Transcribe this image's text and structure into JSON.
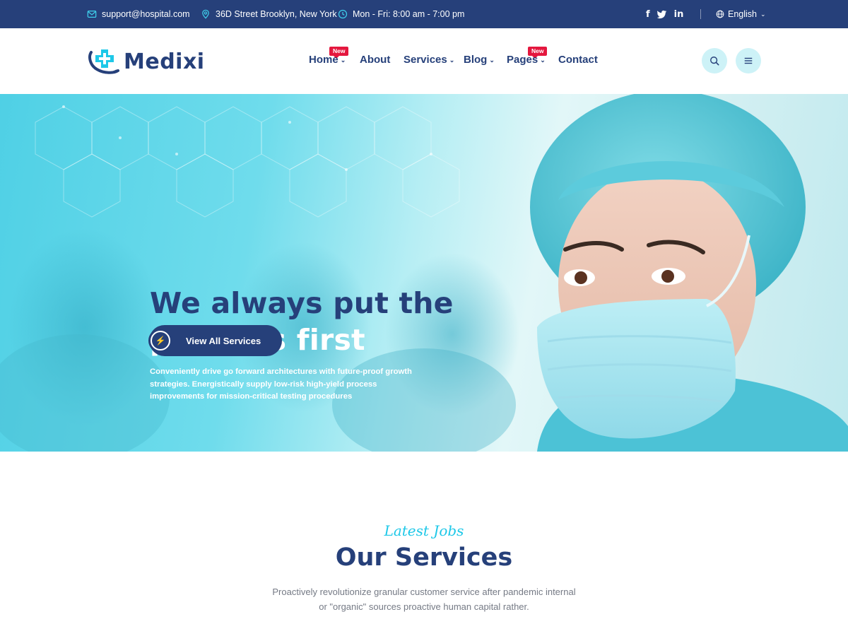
{
  "topbar": {
    "email": "support@hospital.com",
    "address": "36D Street Brooklyn, New York",
    "hours": "Mon - Fri: 8:00 am - 7:00 pm",
    "socials": [
      "f",
      "twitter",
      "in"
    ],
    "language": "English"
  },
  "brand": {
    "name": "Medixi"
  },
  "nav": {
    "items": [
      {
        "label": "Home",
        "has_dropdown": true,
        "badge": "New"
      },
      {
        "label": "About",
        "has_dropdown": false
      },
      {
        "label": "Services",
        "has_dropdown": true
      },
      {
        "label": "Blog",
        "has_dropdown": true
      },
      {
        "label": "Pages",
        "has_dropdown": true,
        "badge": "New"
      },
      {
        "label": "Contact",
        "has_dropdown": false
      }
    ]
  },
  "hero": {
    "headline_line1": "We always put the",
    "headline_line2": "patients first",
    "description": "Conveniently drive go forward architectures with future-proof growth strategies. Energistically supply low-risk high-yield process improvements for mission-critical testing procedures",
    "cta_label": "View All Services"
  },
  "services": {
    "kicker": "Latest Jobs",
    "title": "Our Services",
    "description": "Proactively revolutionize granular customer service after pandemic internal or \"organic\" sources proactive human capital rather."
  },
  "colors": {
    "primary": "#26407a",
    "accent": "#1ec8e8",
    "badge": "#e4173e",
    "icon_button_bg": "#cdf2f7"
  }
}
